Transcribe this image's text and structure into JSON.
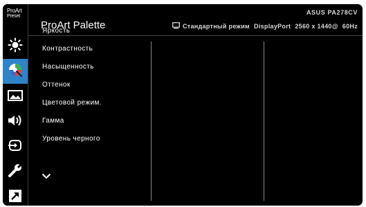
{
  "header": {
    "title": "ProArt Palette",
    "model": "ASUS PA278CV",
    "mode": "Стандартный режим",
    "input": "DisplayPort",
    "resolution": "2560 x 1440@",
    "refresh": "60Hz"
  },
  "rail": {
    "preset_label_1": "ProArt",
    "preset_label_2": "Preset",
    "items": [
      {
        "icon": "brightness-icon"
      },
      {
        "icon": "palette-icon",
        "active": true
      },
      {
        "icon": "image-icon"
      },
      {
        "icon": "sound-icon"
      },
      {
        "icon": "input-select-icon"
      },
      {
        "icon": "wrench-icon"
      },
      {
        "icon": "shortcut-icon"
      }
    ]
  },
  "menu": {
    "items": [
      "Яркость",
      "Контрастность",
      "Насыщенность",
      "Оттенок",
      "Цветовой режим.",
      "Гамма",
      "Уровень черного"
    ]
  },
  "colors": {
    "background": "#000000",
    "active": "#2f83c9",
    "text": "#ffffff"
  }
}
